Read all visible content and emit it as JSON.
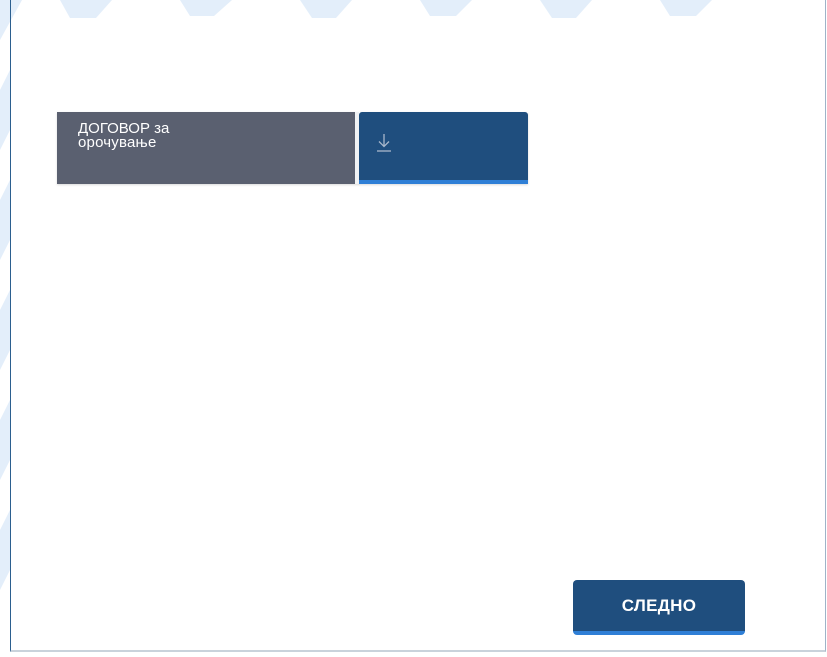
{
  "document": {
    "label_line1": "ДОГОВОР за",
    "label_line2": "орочување"
  },
  "download": {
    "icon": "download-icon"
  },
  "footer": {
    "next_label": "СЛЕДНО"
  },
  "colors": {
    "label_bg": "#5a6070",
    "button_bg": "#1f4e7e",
    "button_accent": "#2f7fd6",
    "watermark": "#dbe9f7"
  }
}
